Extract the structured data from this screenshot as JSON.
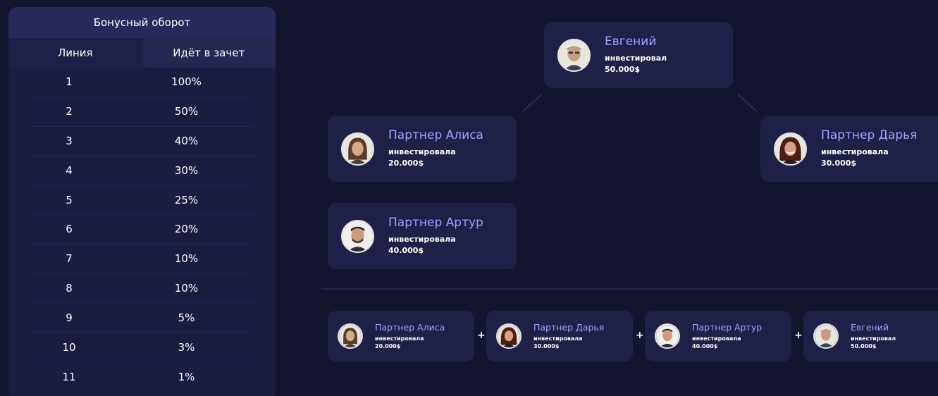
{
  "bonus": {
    "title": "Бонусный оборот",
    "col_line": "Линия",
    "col_credit": "Идёт в зачет",
    "rows": [
      {
        "line": "1",
        "percent": "100%"
      },
      {
        "line": "2",
        "percent": "50%"
      },
      {
        "line": "3",
        "percent": "40%"
      },
      {
        "line": "4",
        "percent": "30%"
      },
      {
        "line": "5",
        "percent": "25%"
      },
      {
        "line": "6",
        "percent": "20%"
      },
      {
        "line": "7",
        "percent": "10%"
      },
      {
        "line": "8",
        "percent": "10%"
      },
      {
        "line": "9",
        "percent": "5%"
      },
      {
        "line": "10",
        "percent": "3%"
      },
      {
        "line": "11",
        "percent": "1%"
      }
    ]
  },
  "tree": {
    "root": {
      "name": "Евгений",
      "action": "инвестировал",
      "amount": "50.000$"
    },
    "alisa": {
      "name": "Партнер Алиса",
      "action": "инвестировала",
      "amount": "20.000$"
    },
    "daria": {
      "name": "Партнер Дарья",
      "action": "инвестировала",
      "amount": "30.000$"
    },
    "artur": {
      "name": "Партнер Артур",
      "action": "инвестировала",
      "amount": "40.000$"
    }
  },
  "sum": {
    "plus": "+",
    "items": [
      {
        "name": "Партнер Алиса",
        "action": "инвестировала",
        "amount": "20.000$"
      },
      {
        "name": "Партнер Дарья",
        "action": "инвестировала",
        "amount": "30.000$"
      },
      {
        "name": "Партнер Артур",
        "action": "инвестировала",
        "amount": "40.000$"
      },
      {
        "name": "Евгений",
        "action": "инвестировал",
        "amount": "50.000$"
      }
    ]
  },
  "colors": {
    "background": "#13142e",
    "card": "#1f2048",
    "accent_name": "#9ea2ff"
  }
}
